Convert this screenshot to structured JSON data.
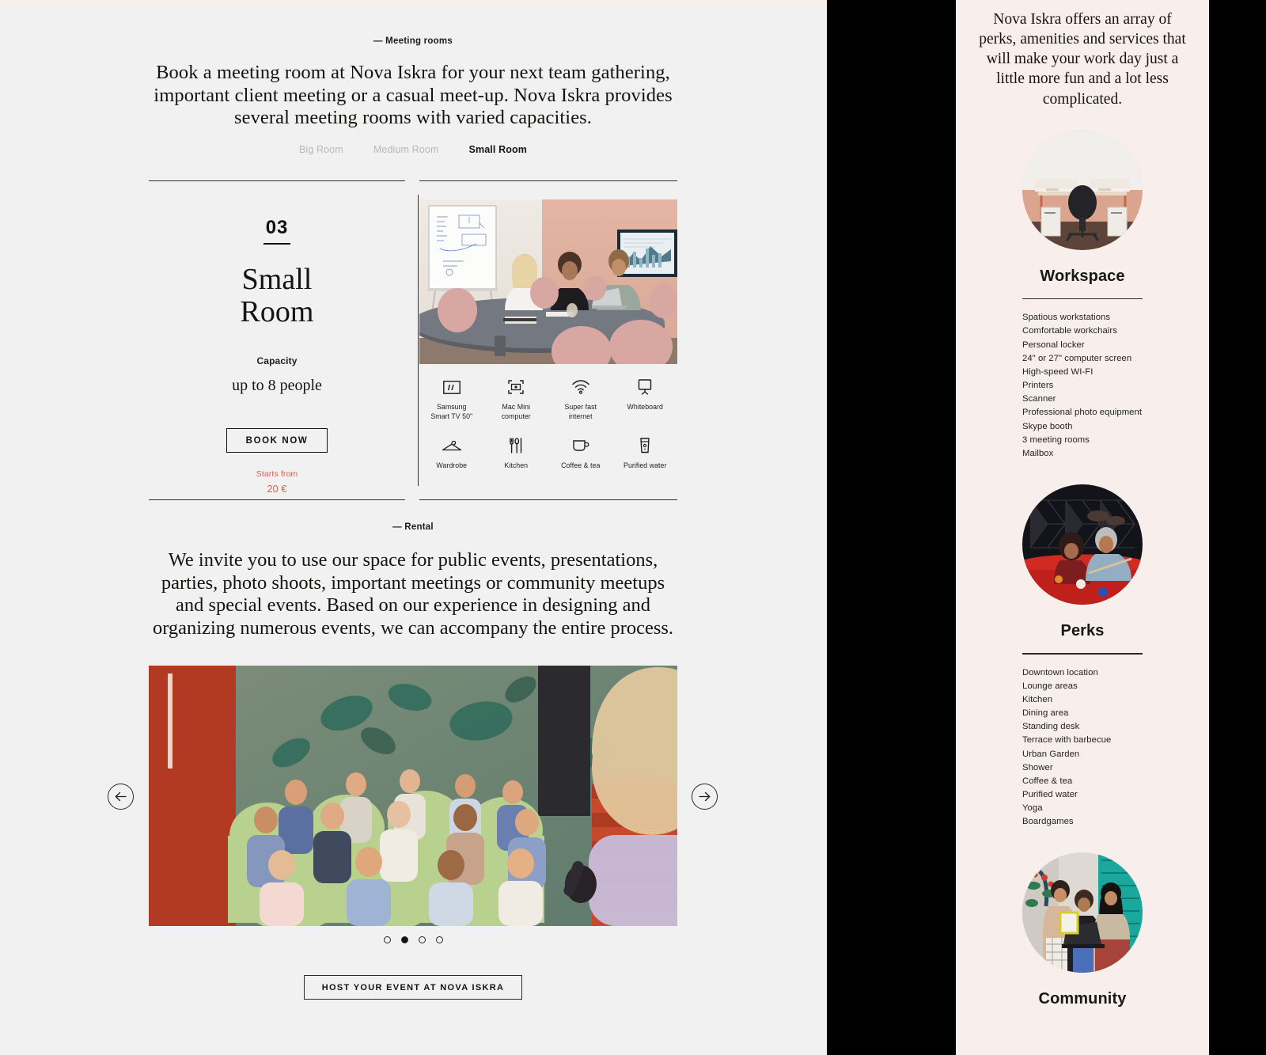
{
  "meeting": {
    "eyebrow": "— Meeting rooms",
    "lead": "Book a meeting room at Nova Iskra for your next team gathering, important client meeting or a casual meet-up. Nova Iskra provides several meeting rooms with varied capacities.",
    "tabs": [
      {
        "label": "Big Room",
        "active": false
      },
      {
        "label": "Medium Room",
        "active": false
      },
      {
        "label": "Small Room",
        "active": true
      }
    ]
  },
  "room": {
    "number": "03",
    "title_line1": "Small",
    "title_line2": "Room",
    "capacity_label": "Capacity",
    "capacity_value": "up to 8 people",
    "book_label": "BOOK NOW",
    "starts_from": "Starts from",
    "price": "20 €",
    "amenities": [
      {
        "icon": "tv-icon",
        "label": "Samsung\nSmart TV 50\""
      },
      {
        "icon": "mac-mini-icon",
        "label": "Mac Mini\ncomputer"
      },
      {
        "icon": "wifi-icon",
        "label": "Super fast\ninternet"
      },
      {
        "icon": "whiteboard-icon",
        "label": "Whiteboard"
      },
      {
        "icon": "hanger-icon",
        "label": "Wardrobe"
      },
      {
        "icon": "cutlery-icon",
        "label": "Kitchen"
      },
      {
        "icon": "coffee-cup-icon",
        "label": "Coffee & tea"
      },
      {
        "icon": "water-glass-icon",
        "label": "Purified water"
      }
    ]
  },
  "rental": {
    "eyebrow": "— Rental",
    "paragraph": "We invite you to use our space for public events, presentations, parties, photo shoots, important meetings or community meetups and special events. Based on our experience in designing and organizing numerous events, we can accompany the entire process.",
    "prev_label": "←",
    "next_label": "→",
    "dots_total": 4,
    "dots_active_index": 1,
    "host_button": "HOST YOUR EVENT AT NOVA ISKRA"
  },
  "sidebar": {
    "intro": "Nova Iskra offers an array of perks, amenities and services that will make your work day just a little more fun and a lot less complicated.",
    "sections": [
      {
        "image": "workspace-photo",
        "heading": "Workspace",
        "items": [
          "Spatious workstations",
          "Comfortable workchairs",
          "Personal locker",
          "24\" or 27\" computer screen",
          "High-speed WI-FI",
          "Printers",
          "Scanner",
          "Professional photo equipment",
          "Skype booth",
          "3 meeting rooms",
          "Mailbox"
        ]
      },
      {
        "image": "perks-photo",
        "heading": "Perks",
        "items": [
          "Downtown location",
          "Lounge areas",
          "Kitchen",
          "Dining area",
          "Standing desk",
          "Terrace with barbecue",
          "Urban Garden",
          "Shower",
          "Coffee & tea",
          "Purified water",
          "Yoga",
          "Boardgames"
        ]
      },
      {
        "image": "community-photo",
        "heading": "Community",
        "items": []
      }
    ]
  },
  "colors": {
    "page_bg": "#f2f1f1",
    "panel_bg": "#f8eeeb",
    "accent_price": "#e05a4f",
    "text": "#151515",
    "muted_tab": "#b9b7b6"
  }
}
